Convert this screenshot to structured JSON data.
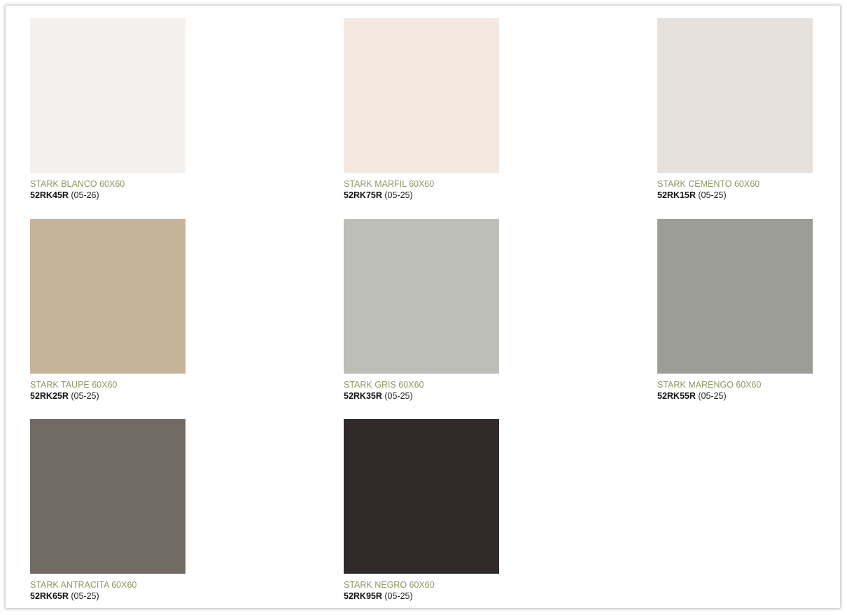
{
  "tiles": [
    {
      "name": "STARK BLANCO 60X60",
      "code": "52RK45R",
      "calibre": "(05-26)",
      "color": "#f4f0ed"
    },
    {
      "name": "STARK MARFIL 60X60",
      "code": "52RK75R",
      "calibre": "(05-25)",
      "color": "#f3e9e0"
    },
    {
      "name": "STARK CEMENTO 60X60",
      "code": "52RK15R",
      "calibre": "(05-25)",
      "color": "#e6e1dc"
    },
    {
      "name": "STARK TAUPE 60X60",
      "code": "52RK25R",
      "calibre": "(05-25)",
      "color": "#c5b39a"
    },
    {
      "name": "STARK GRIS 60X60",
      "code": "52RK35R",
      "calibre": "(05-25)",
      "color": "#bebeb9"
    },
    {
      "name": "STARK MARENGO 60X60",
      "code": "52RK55R",
      "calibre": "(05-25)",
      "color": "#9d9d98"
    },
    {
      "name": "STARK ANTRACITA 60X60",
      "code": "52RK65R",
      "calibre": "(05-25)",
      "color": "#716b63"
    },
    {
      "name": "STARK NEGRO 60X60",
      "code": "52RK95R",
      "calibre": "(05-25)",
      "color": "#302a2b"
    }
  ]
}
